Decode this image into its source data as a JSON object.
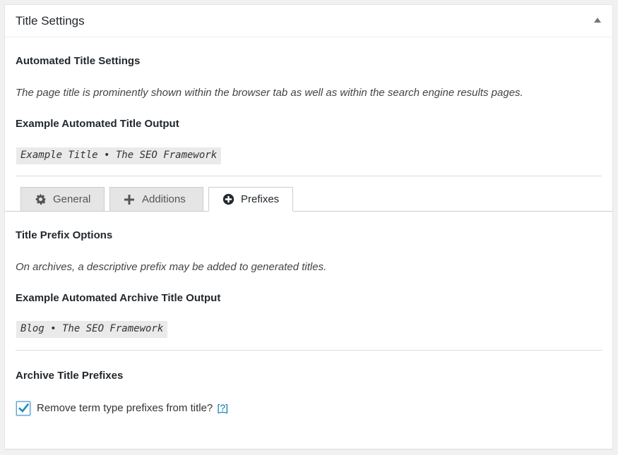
{
  "panel": {
    "title": "Title Settings"
  },
  "automated": {
    "heading": "Automated Title Settings",
    "description": "The page title is prominently shown within the browser tab as well as within the search engine results pages.",
    "example_heading": "Example Automated Title Output",
    "example_value": "Example Title • The SEO Framework"
  },
  "tabs": [
    {
      "label": "General",
      "icon": "gear-icon"
    },
    {
      "label": "Additions",
      "icon": "plus-icon"
    },
    {
      "label": "Prefixes",
      "icon": "plus-circle-icon",
      "active": true
    }
  ],
  "prefixes": {
    "heading": "Title Prefix Options",
    "description": "On archives, a descriptive prefix may be added to generated titles.",
    "example_heading": "Example Automated Archive Title Output",
    "example_value": "Blog • The SEO Framework",
    "options_heading": "Archive Title Prefixes",
    "checkbox_label": "Remove term type prefixes from title?",
    "checkbox_checked": true,
    "help_link": "[?]"
  },
  "colors": {
    "accent": "#0073aa",
    "check": "#1e8cbe"
  }
}
